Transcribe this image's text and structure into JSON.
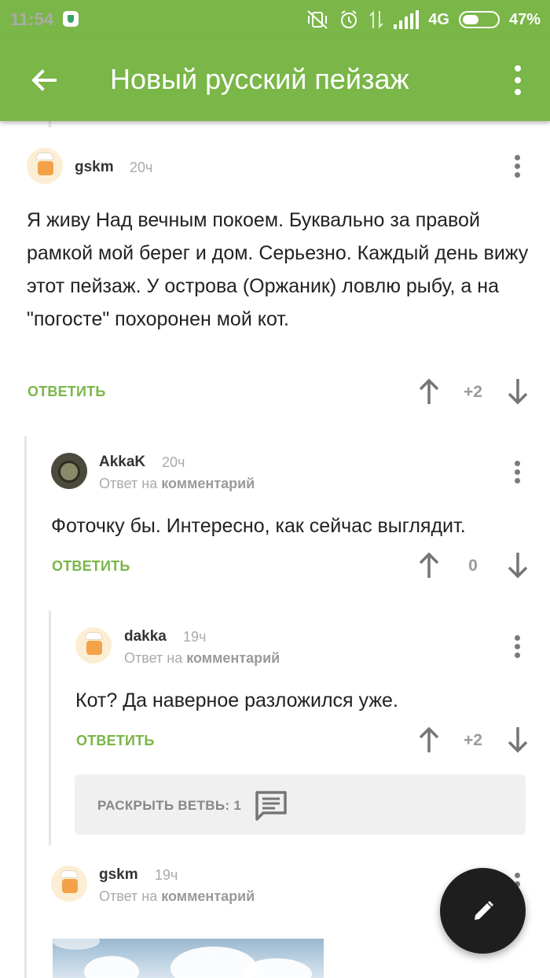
{
  "status_bar": {
    "time": "11:54",
    "network": "4G",
    "battery_percent": "47%",
    "battery_level": 0.47
  },
  "app_bar": {
    "title": "Новый русский пейзаж",
    "back_icon": "arrow-left-icon",
    "menu_icon": "more-vert-icon"
  },
  "comments": [
    {
      "author": "gskm",
      "time": "20ч",
      "text": "Я живу Над вечным покоем. Буквально за правой рамкой мой берег и дом.  Серьезно. Каждый день вижу этот пейзаж. У острова (Оржаник) ловлю рыбу, а на \"погосте\" похоронен мой кот.",
      "reply_label": "ОТВЕТИТЬ",
      "score": "+2"
    },
    {
      "author": "AkkaK",
      "time": "20ч",
      "reply_to_prefix": "Ответ на",
      "reply_to_link": "комментарий",
      "text": "Фоточку бы. Интересно, как сейчас выглядит.",
      "reply_label": "ОТВЕТИТЬ",
      "score": "0"
    },
    {
      "author": "dakka",
      "time": "19ч",
      "reply_to_prefix": "Ответ на",
      "reply_to_link": "комментарий",
      "text": "Кот? Да наверное разложился уже.",
      "reply_label": "ОТВЕТИТЬ",
      "score": "+2"
    },
    {
      "author": "gskm",
      "time": "19ч",
      "reply_to_prefix": "Ответ на",
      "reply_to_link": "комментарий"
    }
  ],
  "expand_branch": {
    "label": "РАСКРЫТЬ ВЕТВЬ: 1",
    "icon": "comment-icon"
  },
  "fab": {
    "icon": "pencil-icon"
  },
  "colors": {
    "accent": "#7ab648",
    "fab": "#1e1e1e"
  }
}
